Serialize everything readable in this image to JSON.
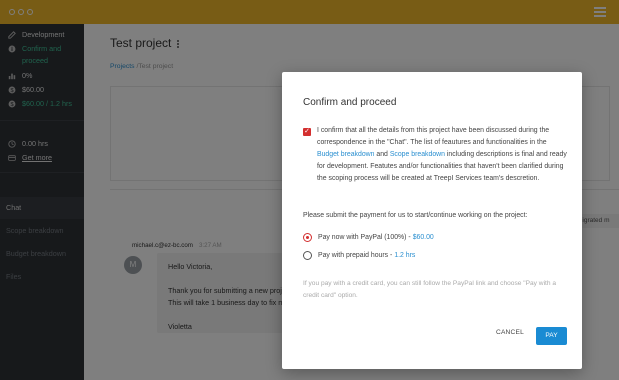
{
  "sidebar": {
    "items": [
      {
        "icon": "edit-icon",
        "label": "Development"
      },
      {
        "icon": "info-icon",
        "label_line1": "Confirm and",
        "label_line2": "proceed"
      },
      {
        "icon": "bar-chart-icon",
        "label": "0%"
      },
      {
        "icon": "dollar-icon",
        "label": "$60.00"
      },
      {
        "icon": "dollar-icon",
        "label": "$60.00 / 1.2 hrs"
      }
    ],
    "time": {
      "icon": "clock-icon",
      "label": "0.00 hrs"
    },
    "more": {
      "icon": "credit-card-icon",
      "label": "Get more"
    },
    "nav": [
      "Chat",
      "Scope breakdown",
      "Budget breakdown",
      "Files"
    ]
  },
  "page": {
    "title": "Test project",
    "breadcrumb_link": "Projects",
    "breadcrumb_rest": "/Test project"
  },
  "chat": {
    "sender": "michael.c@ez-bc.com",
    "time": "3:27 AM",
    "avatar": "M",
    "lines": [
      "Hello Victoria,",
      "Thank you for submitting a new proj",
      "This will take 1 business day to fix m",
      "Violetta"
    ],
    "side_chip": "migrated m"
  },
  "modal": {
    "title": "Confirm and proceed",
    "terms_part1": "I confirm that all the details from this project have been discussed during the correspondence in the \"Chat\". The list of feautures and functionalities in the",
    "terms_link1": "Budget breakdown",
    "terms_and": "and",
    "terms_link2": "Scope breakdown",
    "terms_part2": "including descriptions is final and ready for development. Featutes and/or functionalities that haven't been clarified during the scoping process will be created at TreepI Services team's descretion.",
    "prompt": "Please submit the payment for us to start/continue working on the project:",
    "option1_label": "Pay now with PayPal (100%) -",
    "option1_amount": "$60.00",
    "option2_label": "Pay with prepaid hours -",
    "option2_amount": "1.2 hrs",
    "note": "If you pay with a credit card, you can still follow the PayPal link and choose \"Pay with a credit card\" option.",
    "cancel": "CANCEL",
    "pay": "PAY"
  }
}
